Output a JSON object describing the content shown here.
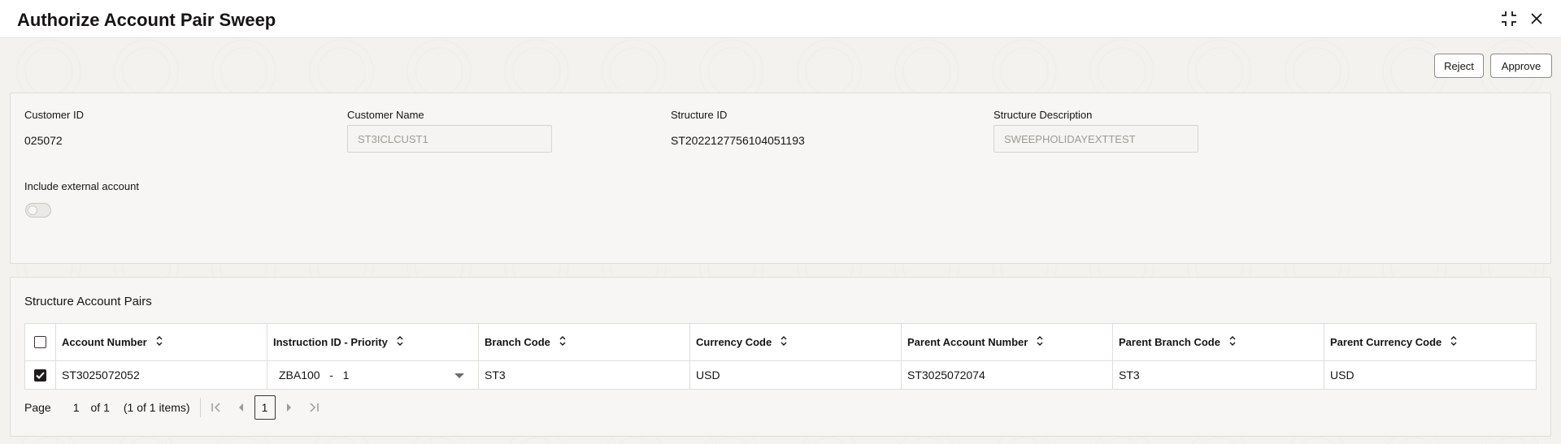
{
  "header": {
    "title": "Authorize Account Pair Sweep",
    "icons": {
      "minimize": "collapse-icon",
      "close": "close-icon"
    }
  },
  "actions": {
    "reject_label": "Reject",
    "approve_label": "Approve"
  },
  "details": {
    "customer_id_label": "Customer ID",
    "customer_id_value": "025072",
    "customer_name_label": "Customer Name",
    "customer_name_value": "ST3ICLCUST1",
    "structure_id_label": "Structure ID",
    "structure_id_value": "ST2022127756104051193",
    "structure_description_label": "Structure Description",
    "structure_description_value": "SWEEPHOLIDAYEXTTEST",
    "include_external_label": "Include external account",
    "include_external_value": false
  },
  "pairs": {
    "section_title": "Structure Account Pairs",
    "columns": [
      "Account Number",
      "Instruction ID - Priority",
      "Branch Code",
      "Currency Code",
      "Parent Account Number",
      "Parent Branch Code",
      "Parent Currency Code"
    ],
    "rows": [
      {
        "selected": true,
        "account_number": "ST3025072052",
        "instruction_id": "ZBA100",
        "priority": "1",
        "branch_code": "ST3",
        "currency_code": "USD",
        "parent_account_number": "ST3025072074",
        "parent_branch_code": "ST3",
        "parent_currency_code": "USD"
      }
    ],
    "pager": {
      "page_label": "Page",
      "page_value": "1",
      "of_label": "of 1",
      "items_label": "(1 of 1 items)",
      "current_page": "1"
    }
  },
  "colors": {
    "accent": "#161513",
    "border": "#e0ddd8",
    "background": "#f5f4f2"
  }
}
